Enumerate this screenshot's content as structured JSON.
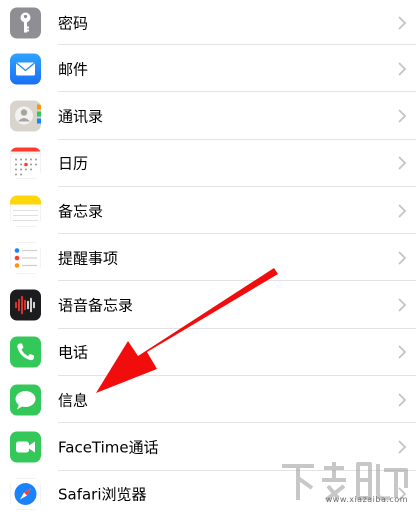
{
  "settings_list": [
    {
      "label": "密码",
      "icon": "key-icon",
      "color": "#8e8e93"
    },
    {
      "label": "邮件",
      "icon": "mail-icon",
      "color": "#1a82fb"
    },
    {
      "label": "通讯录",
      "icon": "contacts-icon",
      "color": "#b9b5ae"
    },
    {
      "label": "日历",
      "icon": "calendar-icon",
      "color": "#ffffff"
    },
    {
      "label": "备忘录",
      "icon": "notes-icon",
      "color": "#ffcc00"
    },
    {
      "label": "提醒事项",
      "icon": "reminders-icon",
      "color": "#ffffff"
    },
    {
      "label": "语音备忘录",
      "icon": "voice-memos-icon",
      "color": "#1c1c1e"
    },
    {
      "label": "电话",
      "icon": "phone-icon",
      "color": "#34c759"
    },
    {
      "label": "信息",
      "icon": "messages-icon",
      "color": "#34c759"
    },
    {
      "label": "FaceTime通话",
      "icon": "facetime-icon",
      "color": "#34c759"
    },
    {
      "label": "Safari浏览器",
      "icon": "safari-icon",
      "color": "#1a82fb"
    }
  ],
  "annotation": {
    "color": "#f20d0d",
    "icon": "red-arrow-icon"
  },
  "watermark": {
    "text": "下载吧",
    "url": "www.xiazaiba.com"
  }
}
